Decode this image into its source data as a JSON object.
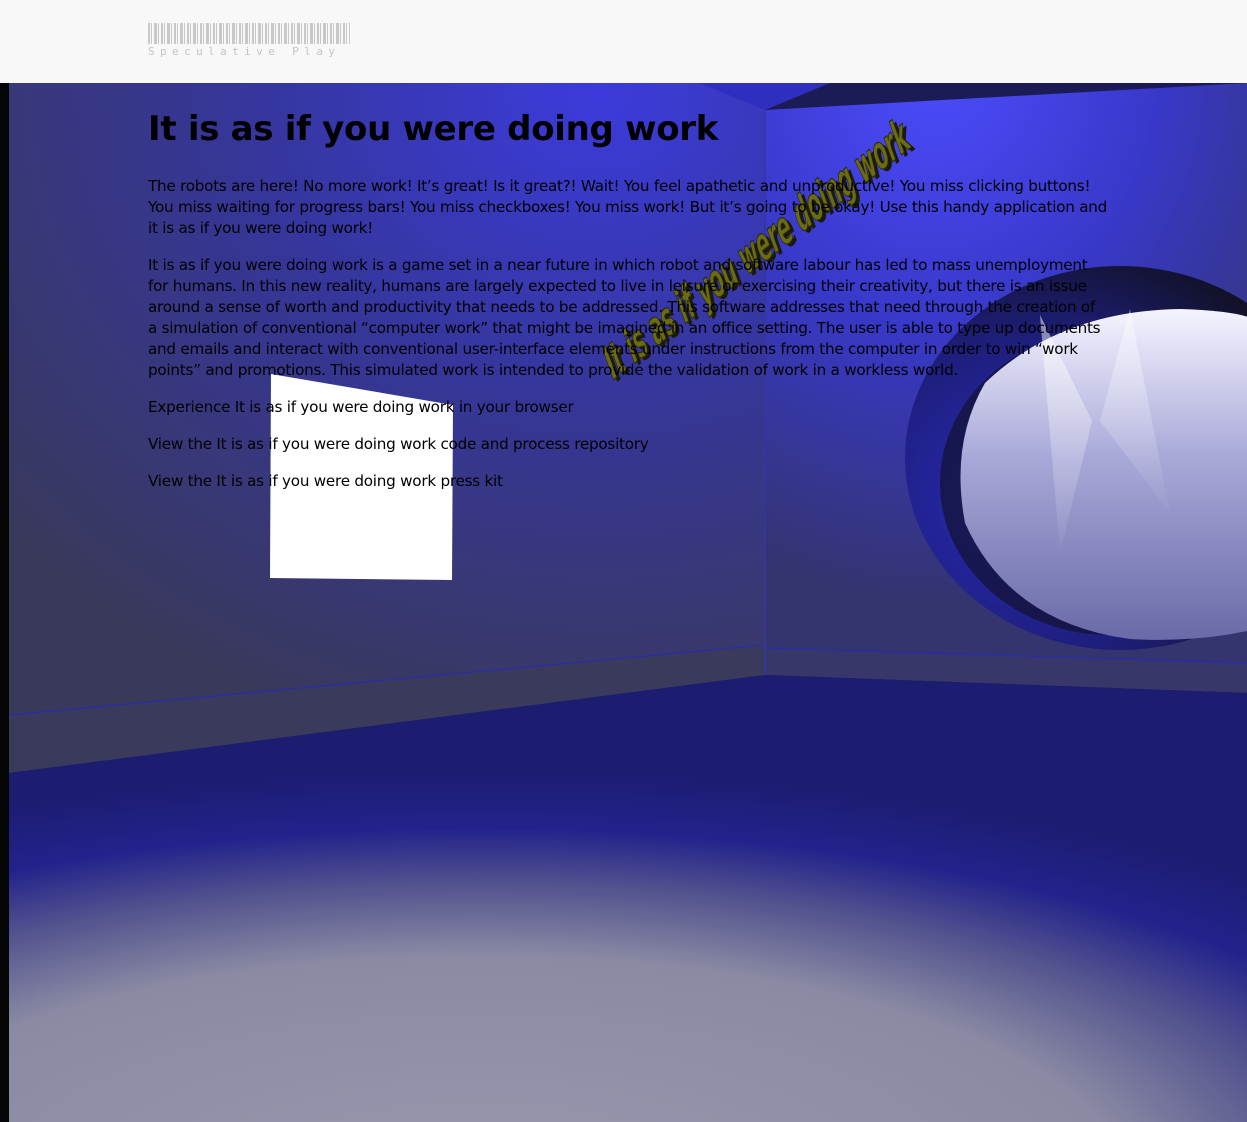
{
  "header": {
    "logo_text": "Speculative Play"
  },
  "article": {
    "title": "It is as if you were doing work",
    "intro": "The robots are here! No more work! It’s great! Is it great?! Wait! You feel apathetic and unproductive! You miss clicking buttons! You miss waiting for progress bars! You miss checkboxes! You miss work! But it’s going to be okay! Use this handy application and it is as if you were doing work!",
    "description": "It is as if you were doing work is a game set in a near future in which robot and software labour has led to mass unemployment for humans. In this new reality, humans are largely expected to live in leisure or exercising their creativity, but there is an issue around a sense of worth and productivity that needs to be addressed. This software addresses that need through the creation of a simulation of conventional “computer work” that might be imagined in an office setting. The user is able to type up documents and emails and interact with conventional user-interface elements under instructions from the computer in order to win “work points” and promotions. This simulated work is intended to provide the validation of work in a workless world.",
    "links": [
      "Experience It is as if you were doing work in your browser",
      "View the It is as if you were doing work code and process repository",
      "View the It is as if you were doing work press kit"
    ]
  },
  "scene": {
    "floating_text": "It is as if you were doing work",
    "colors": {
      "wall_blue": "#3a3ae0",
      "wall_dark": "#3a3a5e",
      "floor_light": "#8e8ea6",
      "text_3d": "#5a5a12",
      "panel": "#ffffff"
    }
  }
}
